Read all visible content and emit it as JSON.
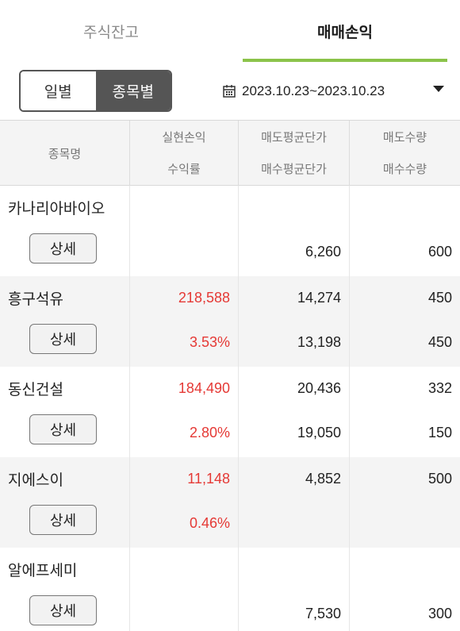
{
  "tabs": {
    "stock_balance": "주식잔고",
    "trade_pnl": "매매손익"
  },
  "toggle": {
    "daily": "일별",
    "by_stock": "종목별"
  },
  "date_range": "2023.10.23~2023.10.23",
  "table": {
    "headers": {
      "name": "종목명",
      "realized_pnl": "실현손익",
      "return_rate": "수익률",
      "avg_sell_price": "매도평균단가",
      "avg_buy_price": "매수평균단가",
      "sell_qty": "매도수량",
      "buy_qty": "매수수량"
    },
    "detail_label": "상세",
    "rows": [
      {
        "name": "카나리아바이오",
        "realized_pnl": "",
        "return_rate": "",
        "avg_sell_price": "",
        "avg_buy_price": "6,260",
        "sell_qty": "",
        "buy_qty": "600"
      },
      {
        "name": "흥구석유",
        "realized_pnl": "218,588",
        "return_rate": "3.53%",
        "avg_sell_price": "14,274",
        "avg_buy_price": "13,198",
        "sell_qty": "450",
        "buy_qty": "450"
      },
      {
        "name": "동신건설",
        "realized_pnl": "184,490",
        "return_rate": "2.80%",
        "avg_sell_price": "20,436",
        "avg_buy_price": "19,050",
        "sell_qty": "332",
        "buy_qty": "150"
      },
      {
        "name": "지에스이",
        "realized_pnl": "11,148",
        "return_rate": "0.46%",
        "avg_sell_price": "4,852",
        "avg_buy_price": "",
        "sell_qty": "500",
        "buy_qty": ""
      },
      {
        "name": "알에프세미",
        "realized_pnl": "",
        "return_rate": "",
        "avg_sell_price": "",
        "avg_buy_price": "7,530",
        "sell_qty": "",
        "buy_qty": "300"
      }
    ]
  },
  "colors": {
    "accent_underline": "#8bc34a",
    "profit_red": "#e53935",
    "toggle_active": "#555555"
  }
}
